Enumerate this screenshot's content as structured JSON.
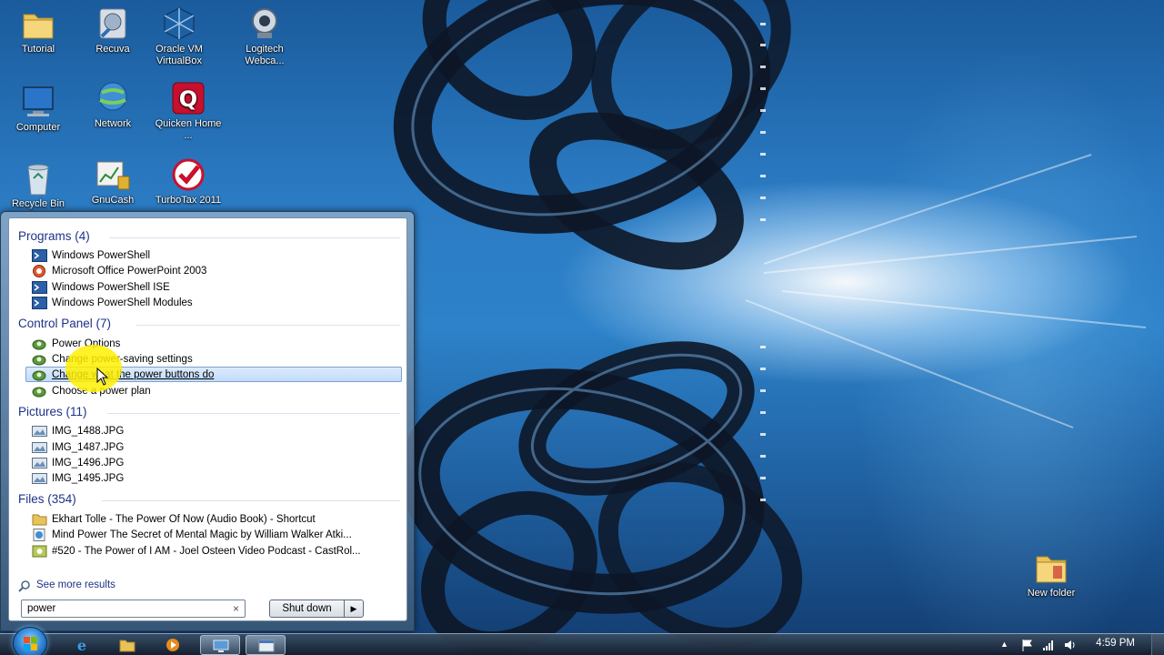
{
  "desktop": {
    "icons": [
      {
        "label": "Tutorial",
        "icon": "folder-icon"
      },
      {
        "label": "Recuva",
        "icon": "recuva-icon"
      },
      {
        "label": "Oracle VM VirtualBox",
        "icon": "virtualbox-icon"
      },
      {
        "label": "Logitech Webca...",
        "icon": "webcam-icon"
      },
      {
        "label": "Computer",
        "icon": "computer-icon"
      },
      {
        "label": "Network",
        "icon": "network-icon"
      },
      {
        "label": "Quicken Home ...",
        "icon": "quicken-icon"
      },
      {
        "label": "Recycle Bin",
        "icon": "recycle-bin-icon"
      },
      {
        "label": "GnuCash",
        "icon": "gnucash-icon"
      },
      {
        "label": "TurboTax 2011",
        "icon": "turbotax-icon"
      },
      {
        "label": "New folder",
        "icon": "folder-icon"
      }
    ]
  },
  "start_menu": {
    "groups": [
      {
        "title": "Programs (4)",
        "items": [
          {
            "label": "Windows PowerShell",
            "icon": "powershell-icon"
          },
          {
            "label": "Microsoft Office PowerPoint 2003",
            "icon": "powerpoint-icon"
          },
          {
            "label": "Windows PowerShell ISE",
            "icon": "powershell-icon"
          },
          {
            "label": "Windows PowerShell Modules",
            "icon": "powershell-icon"
          }
        ]
      },
      {
        "title": "Control Panel (7)",
        "items": [
          {
            "label": "Power Options",
            "icon": "power-options-icon"
          },
          {
            "label": "Change power-saving settings",
            "icon": "power-options-icon"
          },
          {
            "label": "Change what the power buttons do",
            "icon": "power-options-icon",
            "selected": true
          },
          {
            "label": "Choose a power plan",
            "icon": "power-options-icon"
          }
        ]
      },
      {
        "title": "Pictures (11)",
        "items": [
          {
            "label": "IMG_1488.JPG",
            "icon": "image-file-icon"
          },
          {
            "label": "IMG_1487.JPG",
            "icon": "image-file-icon"
          },
          {
            "label": "IMG_1496.JPG",
            "icon": "image-file-icon"
          },
          {
            "label": "IMG_1495.JPG",
            "icon": "image-file-icon"
          }
        ]
      },
      {
        "title": "Files (354)",
        "items": [
          {
            "label": "Ekhart Tolle - The Power Of Now (Audio Book) - Shortcut",
            "icon": "folder-shortcut-icon"
          },
          {
            "label": "Mind Power The Secret of Mental Magic by William Walker Atki...",
            "icon": "internet-shortcut-icon"
          },
          {
            "label": "#520 - The Power of I AM - Joel Osteen Video Podcast - CastRol...",
            "icon": "podcast-file-icon"
          }
        ]
      }
    ],
    "see_more": "See more results",
    "search_value": "power",
    "clear_glyph": "×",
    "shutdown_label": "Shut down",
    "shutdown_arrow": "▶"
  },
  "taskbar": {
    "buttons": [
      {
        "name": "internet-explorer",
        "icon": "internet-explorer-icon"
      },
      {
        "name": "windows-explorer",
        "icon": "explorer-folder-icon"
      },
      {
        "name": "media-player",
        "icon": "media-player-icon"
      },
      {
        "name": "remote-desktop",
        "icon": "remote-desktop-icon"
      },
      {
        "name": "window-app",
        "icon": "app-window-icon"
      }
    ],
    "clock": "4:59 PM",
    "tray_up_arrow": "▲"
  },
  "colors": {
    "group_header": "#1e3287",
    "selection_fill": "#c1dbfc",
    "selection_border": "#7da2ce",
    "cursor_highlight": "#fff000"
  }
}
